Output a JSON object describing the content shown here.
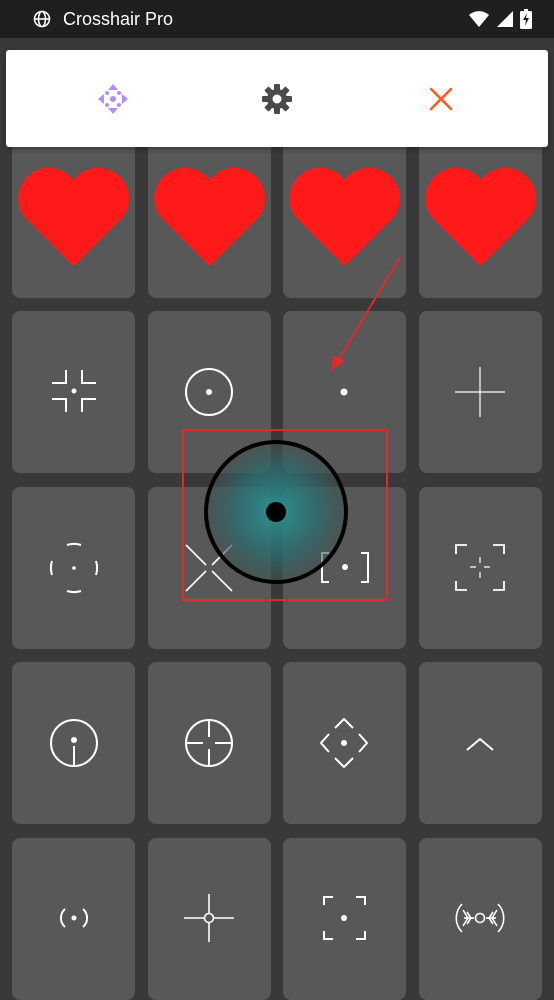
{
  "status_bar": {
    "app_title": "Crosshair Pro"
  },
  "toolbar": {
    "buttons": [
      {
        "name": "move",
        "icon": "move-arrows-icon",
        "color": "#b58cff"
      },
      {
        "name": "settings",
        "icon": "gear-icon",
        "color": "#4a4a4a"
      },
      {
        "name": "close",
        "icon": "close-icon",
        "color": "#ff5a1f"
      }
    ]
  },
  "crosshair_grid": {
    "columns": 4,
    "tiles": [
      {
        "style": "circle-dashed-dot",
        "favorite": true
      },
      {
        "style": "cross-gap-dot",
        "favorite": true
      },
      {
        "style": "circle-t-dot",
        "favorite": true
      },
      {
        "style": "x-dot",
        "favorite": true
      },
      {
        "style": "corner-brackets-dot",
        "favorite": false
      },
      {
        "style": "circle-dot",
        "favorite": false
      },
      {
        "style": "dot",
        "favorite": false
      },
      {
        "style": "thin-cross",
        "favorite": false
      },
      {
        "style": "circle-arcs-dot",
        "favorite": false
      },
      {
        "style": "x-large",
        "favorite": false
      },
      {
        "style": "brackets-dot",
        "favorite": false
      },
      {
        "style": "square-corners-cross",
        "favorite": false
      },
      {
        "style": "circle-dot-line",
        "favorite": false
      },
      {
        "style": "circle-crosshair",
        "favorite": false
      },
      {
        "style": "diamond-arrows-dot",
        "favorite": false
      },
      {
        "style": "chevron-up",
        "favorite": false
      },
      {
        "style": "paren-dot",
        "favorite": false
      },
      {
        "style": "cross-small-circle",
        "favorite": false
      },
      {
        "style": "square-corners-dot",
        "favorite": false
      },
      {
        "style": "ornate-circle",
        "favorite": false
      }
    ]
  },
  "crosshair_preview": {
    "ring_color": "#000000",
    "glow_color": "#2a8a8a"
  },
  "annotation": {
    "color": "#e02a2a"
  }
}
